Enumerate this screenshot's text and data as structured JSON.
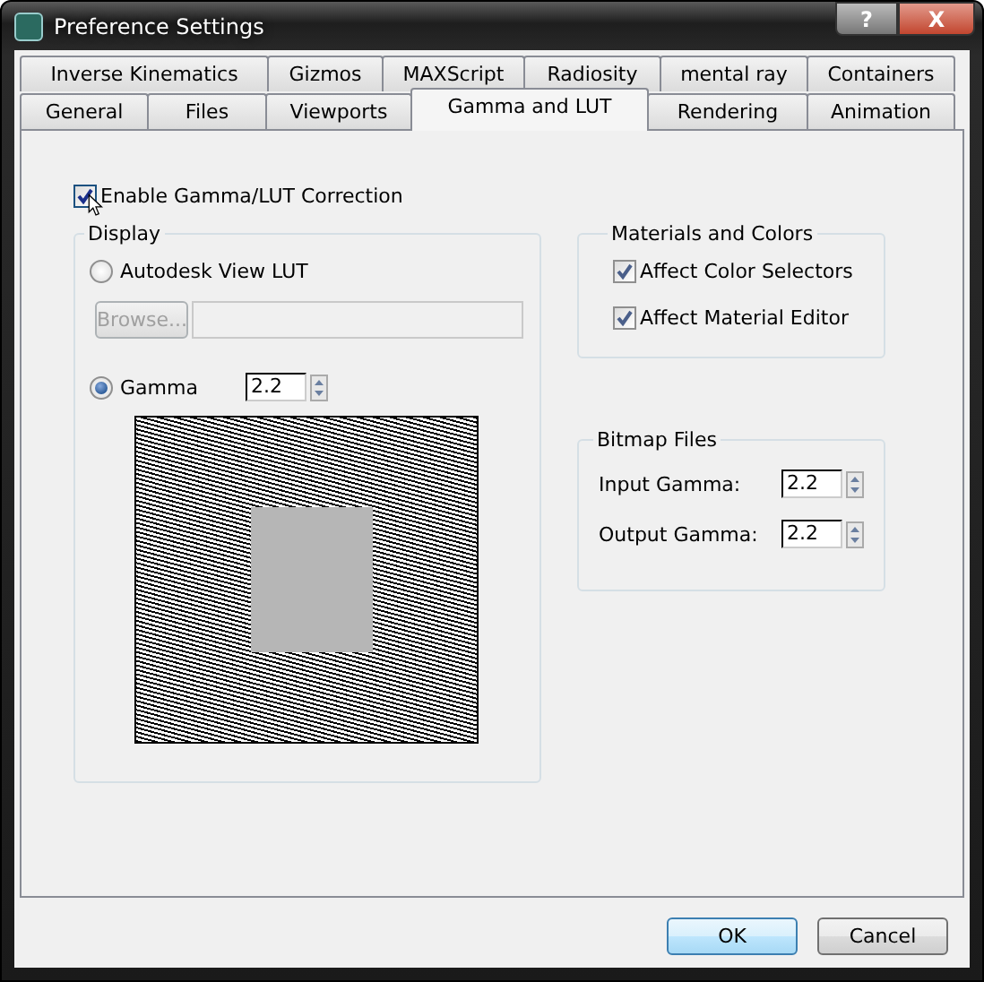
{
  "window": {
    "title": "Preference Settings",
    "help_button": "?",
    "close_button": "X"
  },
  "tab_rows": [
    {
      "tabs": [
        {
          "label": "Inverse Kinematics",
          "selected": false
        },
        {
          "label": "Gizmos",
          "selected": false
        },
        {
          "label": "MAXScript",
          "selected": false
        },
        {
          "label": "Radiosity",
          "selected": false
        },
        {
          "label": "mental ray",
          "selected": false
        },
        {
          "label": "Containers",
          "selected": false
        }
      ]
    },
    {
      "tabs": [
        {
          "label": "General",
          "selected": false
        },
        {
          "label": "Files",
          "selected": false
        },
        {
          "label": "Viewports",
          "selected": false
        },
        {
          "label": "Gamma and LUT",
          "selected": true
        },
        {
          "label": "Rendering",
          "selected": false
        },
        {
          "label": "Animation",
          "selected": false
        }
      ]
    }
  ],
  "enable_correction": {
    "label": "Enable Gamma/LUT Correction",
    "checked": true
  },
  "display": {
    "title": "Display",
    "options": [
      {
        "kind": "lut",
        "label": "Autodesk View LUT",
        "selected": false,
        "browse_button": "Browse...",
        "browse_disabled": true
      },
      {
        "kind": "gamma",
        "label": "Gamma",
        "selected": true,
        "value": "2.2"
      }
    ]
  },
  "materials_and_colors": {
    "title": "Materials and Colors",
    "items": [
      {
        "label": "Affect Color Selectors",
        "checked": true
      },
      {
        "label": "Affect Material Editor",
        "checked": true
      }
    ]
  },
  "bitmap_files": {
    "title": "Bitmap Files",
    "fields": [
      {
        "label": "Input Gamma:",
        "value": "2.2"
      },
      {
        "label": "Output Gamma:",
        "value": "2.2"
      }
    ]
  },
  "buttons": [
    {
      "label": "OK",
      "default": true
    },
    {
      "label": "Cancel",
      "default": false
    }
  ]
}
